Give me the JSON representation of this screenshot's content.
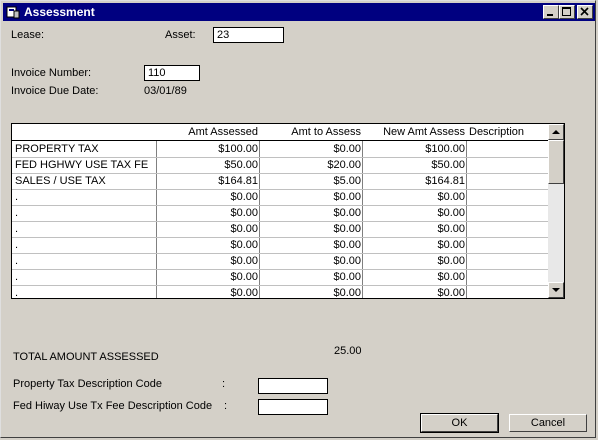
{
  "window": {
    "title": "Assessment"
  },
  "form": {
    "lease_label": "Lease:",
    "asset_label": "Asset:",
    "asset_value": "23",
    "invoice_number_label": "Invoice Number:",
    "invoice_number_value": "110",
    "invoice_due_date_label": "Invoice Due Date:",
    "invoice_due_date_value": "03/01/89"
  },
  "grid": {
    "columns": [
      "",
      "Amt Assessed",
      "Amt to Assess",
      "New Amt Assess",
      "Description"
    ],
    "rows": [
      [
        "PROPERTY TAX",
        "$100.00",
        "$0.00",
        "$100.00",
        ""
      ],
      [
        "FED HGHWY USE TAX FE",
        "$50.00",
        "$20.00",
        "$50.00",
        ""
      ],
      [
        "SALES / USE TAX",
        "$164.81",
        "$5.00",
        "$164.81",
        ""
      ],
      [
        ".",
        "$0.00",
        "$0.00",
        "$0.00",
        ""
      ],
      [
        ".",
        "$0.00",
        "$0.00",
        "$0.00",
        ""
      ],
      [
        ".",
        "$0.00",
        "$0.00",
        "$0.00",
        ""
      ],
      [
        ".",
        "$0.00",
        "$0.00",
        "$0.00",
        ""
      ],
      [
        ".",
        "$0.00",
        "$0.00",
        "$0.00",
        ""
      ],
      [
        ".",
        "$0.00",
        "$0.00",
        "$0.00",
        ""
      ],
      [
        ".",
        "$0.00",
        "$0.00",
        "$0.00",
        ""
      ]
    ]
  },
  "totals": {
    "label": "TOTAL AMOUNT ASSESSED",
    "value": "25.00"
  },
  "codes": {
    "property_tax_label": "Property Tax Description Code",
    "property_tax_colon": ":",
    "property_tax_value": "",
    "fed_hiway_label": "Fed Hiway Use Tx Fee Description Code",
    "fed_hiway_colon": ":",
    "fed_hiway_value": ""
  },
  "buttons": {
    "ok": "OK",
    "cancel": "Cancel"
  }
}
